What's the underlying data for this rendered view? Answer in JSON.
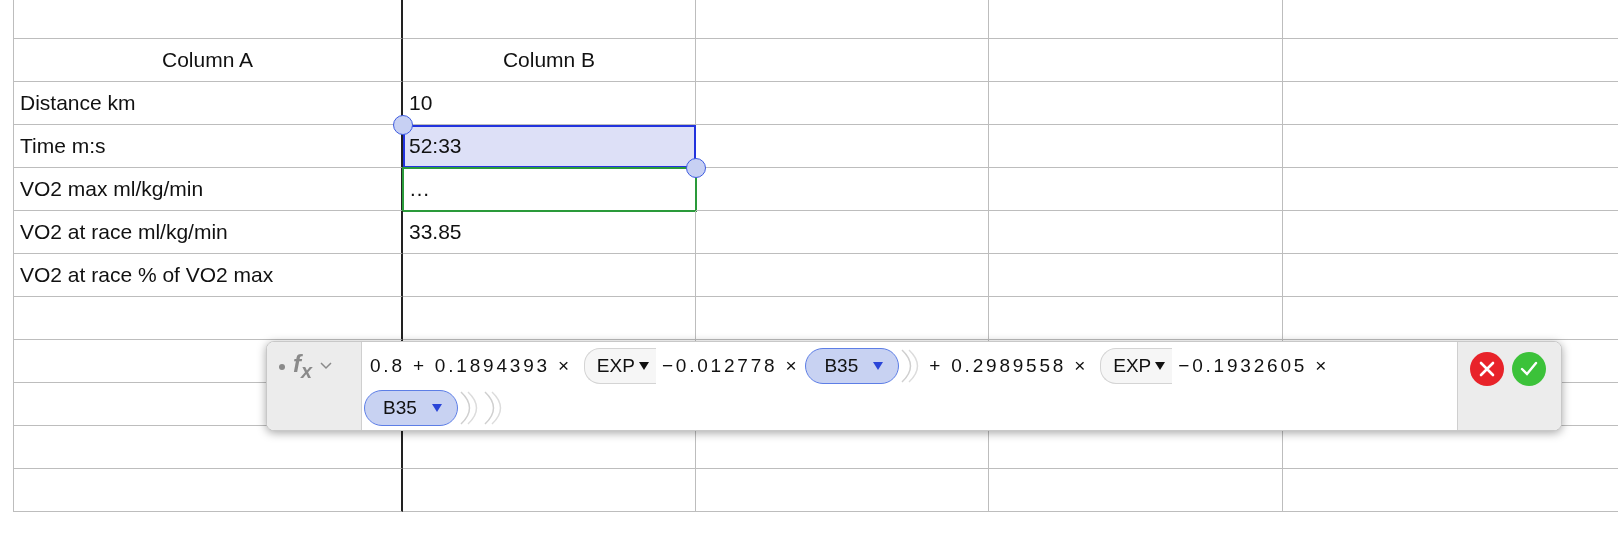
{
  "table": {
    "header": [
      "Column A",
      "Column B"
    ],
    "rows": [
      {
        "label": "Distance km",
        "value": "10",
        "selected": false,
        "editing": false
      },
      {
        "label": "Time m:s",
        "value": "52:33",
        "selected": true,
        "editing": false
      },
      {
        "label": "VO2 max ml/kg/min",
        "value": "…",
        "selected": false,
        "editing": true
      },
      {
        "label": "VO2 at race ml/kg/min",
        "value": "33.85",
        "selected": false,
        "editing": false
      },
      {
        "label": "VO2 at race % of VO2 max",
        "selected": false,
        "editing": false
      }
    ]
  },
  "formula_bar": {
    "label": "f$_{x}$",
    "tokens": [
      {
        "kind": "text",
        "text": "0.8 + 0.1894393 ×"
      },
      {
        "kind": "function",
        "text": "EXP"
      },
      {
        "kind": "text",
        "text": "−0.012778 ×"
      },
      {
        "kind": "reference",
        "text": "B35"
      },
      {
        "kind": "close"
      },
      {
        "kind": "text",
        "text": "+ 0.2989558 ×"
      },
      {
        "kind": "function",
        "text": "EXP"
      },
      {
        "kind": "text",
        "text": "−0.1932605 ×"
      },
      {
        "kind": "reference",
        "text": "B35"
      },
      {
        "kind": "close"
      },
      {
        "kind": "close"
      }
    ]
  }
}
